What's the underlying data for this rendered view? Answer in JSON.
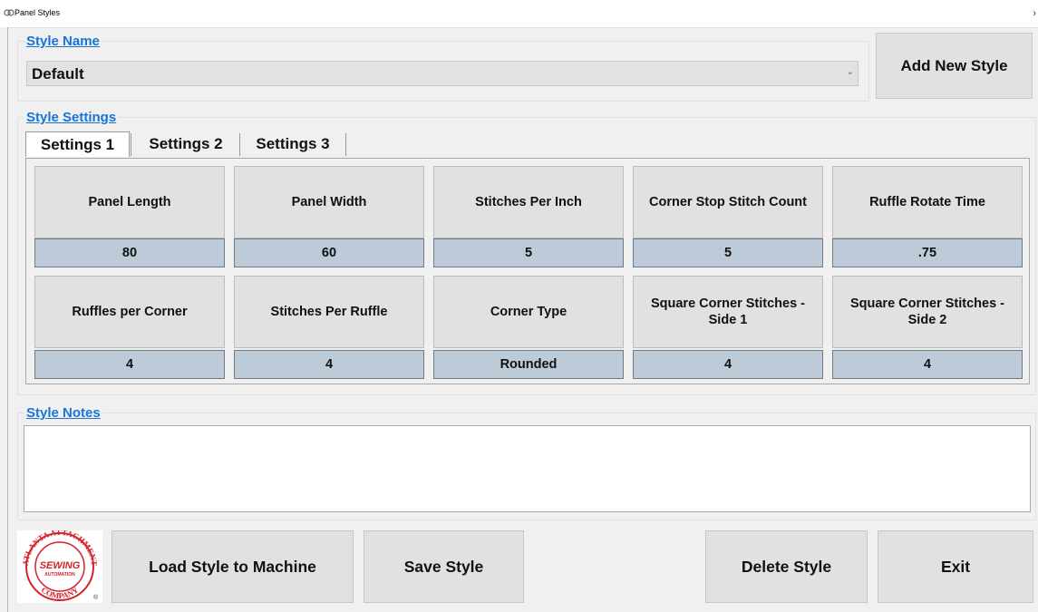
{
  "window": {
    "title": "Panel Styles",
    "close": "›"
  },
  "style_name": {
    "label": "Style Name",
    "value": "Default"
  },
  "buttons": {
    "add_new_style": "Add New Style",
    "load_style": "Load Style to Machine",
    "save_style": "Save Style",
    "delete_style": "Delete Style",
    "exit": "Exit"
  },
  "style_settings": {
    "label": "Style Settings",
    "tabs": [
      "Settings 1",
      "Settings 2",
      "Settings 3"
    ],
    "active_tab": "Settings 1",
    "row1": [
      {
        "label": "Panel Length",
        "value": "80"
      },
      {
        "label": "Panel Width",
        "value": "60"
      },
      {
        "label": "Stitches Per Inch",
        "value": "5"
      },
      {
        "label": "Corner Stop Stitch Count",
        "value": "5"
      },
      {
        "label": "Ruffle Rotate Time",
        "value": ".75"
      }
    ],
    "row2": [
      {
        "label": "Ruffles per Corner",
        "value": "4"
      },
      {
        "label": "Stitches Per Ruffle",
        "value": "4"
      },
      {
        "label": "Corner Type",
        "value": "Rounded"
      },
      {
        "label": "Square Corner Stitches - Side 1",
        "value": "4"
      },
      {
        "label": "Square Corner Stitches - Side 2",
        "value": "4"
      }
    ]
  },
  "style_notes": {
    "label": "Style Notes",
    "value": ""
  },
  "logo": {
    "top_text": "ATLANTA ATTACHMENT",
    "center_text_1": "SEWING",
    "center_text_2": "AUTOMATION",
    "bottom_text": "COMPANY"
  },
  "colors": {
    "accent": "#1a73d6",
    "value_bg": "#bccbd7",
    "button_bg": "#e1e1e1",
    "logo_red": "#d2232a"
  }
}
